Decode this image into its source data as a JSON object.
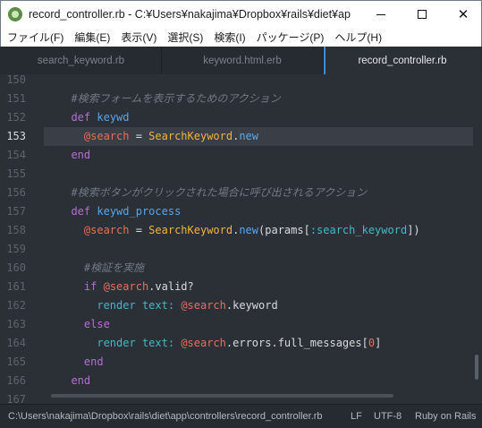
{
  "window": {
    "title": "record_controller.rb - C:¥Users¥nakajima¥Dropbox¥rails¥diet¥app¥m...",
    "minimize": "",
    "maximize": "",
    "close": "✕"
  },
  "menu": [
    "ファイル(F)",
    "編集(E)",
    "表示(V)",
    "選択(S)",
    "検索(I)",
    "パッケージ(P)",
    "ヘルプ(H)"
  ],
  "tabs": [
    {
      "label": "search_keyword.rb",
      "active": false
    },
    {
      "label": "keyword.html.erb",
      "active": false
    },
    {
      "label": "record_controller.rb",
      "active": true
    }
  ],
  "editor": {
    "current_line": "153",
    "lines": [
      {
        "n": "150",
        "parts": []
      },
      {
        "n": "151",
        "parts": [
          {
            "t": "  #検索フォームを表示するためのアクション",
            "c": "com"
          }
        ]
      },
      {
        "n": "152",
        "parts": [
          {
            "t": "  ",
            "c": "plain"
          },
          {
            "t": "def",
            "c": "kw"
          },
          {
            "t": " ",
            "c": "plain"
          },
          {
            "t": "keywd",
            "c": "def"
          }
        ]
      },
      {
        "n": "153",
        "parts": [
          {
            "t": "    ",
            "c": "plain"
          },
          {
            "t": "@search",
            "c": "ivar"
          },
          {
            "t": " = ",
            "c": "plain"
          },
          {
            "t": "SearchKeyword",
            "c": "cls"
          },
          {
            "t": ".",
            "c": "plain"
          },
          {
            "t": "new",
            "c": "fn"
          }
        ]
      },
      {
        "n": "154",
        "parts": [
          {
            "t": "  ",
            "c": "plain"
          },
          {
            "t": "end",
            "c": "kw"
          }
        ]
      },
      {
        "n": "155",
        "parts": []
      },
      {
        "n": "156",
        "parts": [
          {
            "t": "  #検索ボタンがクリックされた場合に呼び出されるアクション",
            "c": "com"
          }
        ]
      },
      {
        "n": "157",
        "parts": [
          {
            "t": "  ",
            "c": "plain"
          },
          {
            "t": "def",
            "c": "kw"
          },
          {
            "t": " ",
            "c": "plain"
          },
          {
            "t": "keywd_process",
            "c": "def"
          }
        ]
      },
      {
        "n": "158",
        "parts": [
          {
            "t": "    ",
            "c": "plain"
          },
          {
            "t": "@search",
            "c": "ivar"
          },
          {
            "t": " = ",
            "c": "plain"
          },
          {
            "t": "SearchKeyword",
            "c": "cls"
          },
          {
            "t": ".",
            "c": "plain"
          },
          {
            "t": "new",
            "c": "fn"
          },
          {
            "t": "(params[",
            "c": "plain"
          },
          {
            "t": ":search_keyword",
            "c": "sym"
          },
          {
            "t": "])",
            "c": "plain"
          }
        ]
      },
      {
        "n": "159",
        "parts": []
      },
      {
        "n": "160",
        "parts": [
          {
            "t": "    #検証を実施",
            "c": "com"
          }
        ]
      },
      {
        "n": "161",
        "parts": [
          {
            "t": "    ",
            "c": "plain"
          },
          {
            "t": "if",
            "c": "kw"
          },
          {
            "t": " ",
            "c": "plain"
          },
          {
            "t": "@search",
            "c": "ivar"
          },
          {
            "t": ".valid?",
            "c": "plain"
          }
        ]
      },
      {
        "n": "162",
        "parts": [
          {
            "t": "      ",
            "c": "plain"
          },
          {
            "t": "render",
            "c": "sym"
          },
          {
            "t": " ",
            "c": "plain"
          },
          {
            "t": "text:",
            "c": "sym"
          },
          {
            "t": " ",
            "c": "plain"
          },
          {
            "t": "@search",
            "c": "ivar"
          },
          {
            "t": ".keyword",
            "c": "plain"
          }
        ]
      },
      {
        "n": "163",
        "parts": [
          {
            "t": "    ",
            "c": "plain"
          },
          {
            "t": "else",
            "c": "kw"
          }
        ]
      },
      {
        "n": "164",
        "parts": [
          {
            "t": "      ",
            "c": "plain"
          },
          {
            "t": "render",
            "c": "sym"
          },
          {
            "t": " ",
            "c": "plain"
          },
          {
            "t": "text:",
            "c": "sym"
          },
          {
            "t": " ",
            "c": "plain"
          },
          {
            "t": "@search",
            "c": "ivar"
          },
          {
            "t": ".errors.full_messages[",
            "c": "plain"
          },
          {
            "t": "0",
            "c": "num"
          },
          {
            "t": "]",
            "c": "plain"
          }
        ]
      },
      {
        "n": "165",
        "parts": [
          {
            "t": "    ",
            "c": "plain"
          },
          {
            "t": "end",
            "c": "kw"
          }
        ]
      },
      {
        "n": "166",
        "parts": [
          {
            "t": "  ",
            "c": "plain"
          },
          {
            "t": "end",
            "c": "kw"
          }
        ]
      },
      {
        "n": "167",
        "parts": []
      }
    ]
  },
  "status": {
    "path": "C:\\Users\\nakajima\\Dropbox\\rails\\diet\\app\\controllers\\record_controller.rb",
    "line_ending": "LF",
    "encoding": "UTF-8",
    "syntax": "Ruby on Rails"
  },
  "colors": {
    "background": "#2b2f36",
    "keyword": "#b86cd6",
    "instance_var": "#e8705a",
    "class": "#f2b53a",
    "symbol": "#46b7c4",
    "function": "#5ba9f0",
    "comment": "#727a86",
    "accent": "#3f8fd8"
  }
}
